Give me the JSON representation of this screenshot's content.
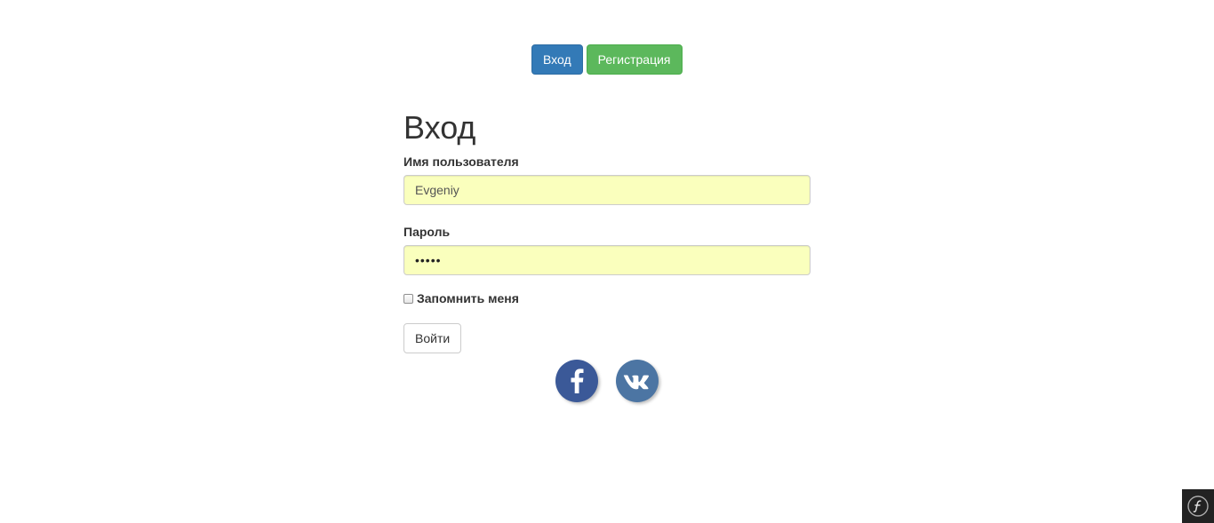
{
  "nav": {
    "login_label": "Вход",
    "register_label": "Регистрация"
  },
  "form": {
    "title": "Вход",
    "username_label": "Имя пользователя",
    "username_value": "Evgeniy",
    "password_label": "Пароль",
    "password_mask": "•••••",
    "remember_label": "Запомнить меня",
    "remember_checked": false,
    "submit_label": "Войти"
  },
  "social": {
    "icons": [
      "facebook-icon",
      "vk-icon"
    ],
    "facebook_color": "#3b5998",
    "vk_color": "#4c75a3"
  },
  "colors": {
    "primary": "#337ab7",
    "success": "#5cb85c",
    "autofill_bg": "#faffbd"
  },
  "toolbar": {
    "icon": "symfony-icon"
  }
}
